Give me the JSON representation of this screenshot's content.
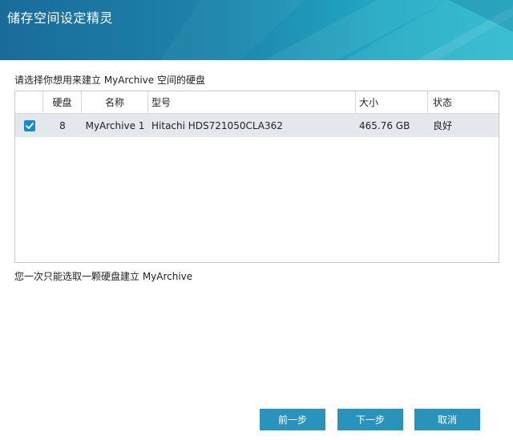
{
  "window": {
    "title": "储存空间设定精灵"
  },
  "prompt": "请选择你想用来建立 MyArchive 空间的硬盘",
  "table": {
    "columns": [
      "",
      "硬盘",
      "名称",
      "型号",
      "大小",
      "状态"
    ],
    "rows": [
      {
        "checked": true,
        "disk": "8",
        "name": "MyArchive 1",
        "model": "Hitachi HDS721050CLA362",
        "size": "465.76 GB",
        "status": "良好"
      }
    ]
  },
  "note": "您一次只能选取一颗硬盘建立 MyArchive",
  "buttons": {
    "prev": "前一步",
    "next": "下一步",
    "cancel": "取消"
  },
  "colors": {
    "header_left": "#1a6b9a",
    "header_right": "#25b8cc",
    "button": "#2a93bc",
    "checkbox": "#1a8cc4",
    "selected_row": "#e4e7eb"
  },
  "icons": {
    "checkbox": "checkmark-icon"
  }
}
